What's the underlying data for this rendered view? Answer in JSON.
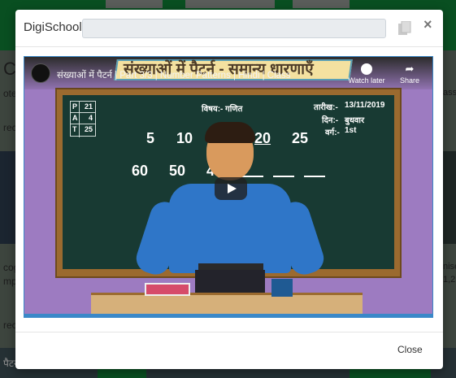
{
  "background": {
    "left_letter": "C",
    "left_snippets": [
      "otenc",
      "rec",
      "cog",
      "mple",
      "rec",
      "पैटर्न"
    ],
    "right_snippets": [
      "ass",
      "nise",
      "1,2"
    ]
  },
  "modal": {
    "title": "DigiSchool",
    "url_value": "",
    "close_x": "×",
    "footer_close": "Close"
  },
  "video": {
    "title": "संख्याओं में पैटर्न | Part 3/3 | Number Patterns | Hindi | Class",
    "banner_text": "संख्याओं में पैटर्न - समान्य धारणाएँ",
    "watch_later": "Watch later",
    "share": "Share",
    "board": {
      "pat": [
        {
          "k": "P",
          "v": "21"
        },
        {
          "k": "A",
          "v": "4"
        },
        {
          "k": "T",
          "v": "25"
        }
      ],
      "subject": "विषय:- गणित",
      "date_label": "तारीख:-",
      "date_value": "13/11/2019",
      "day_label": "दिन:-",
      "day_value": "बुधवार",
      "class_label": "वर्ग:-",
      "class_value": "1st",
      "row1": [
        "5",
        "10",
        "20",
        "25"
      ],
      "row2": [
        "60",
        "50",
        "4"
      ]
    }
  },
  "colors": {
    "header_green": "#0f7a33",
    "video_purple": "#9d7bc1",
    "board_green": "#183a33",
    "shirt_blue": "#2f76c8"
  }
}
